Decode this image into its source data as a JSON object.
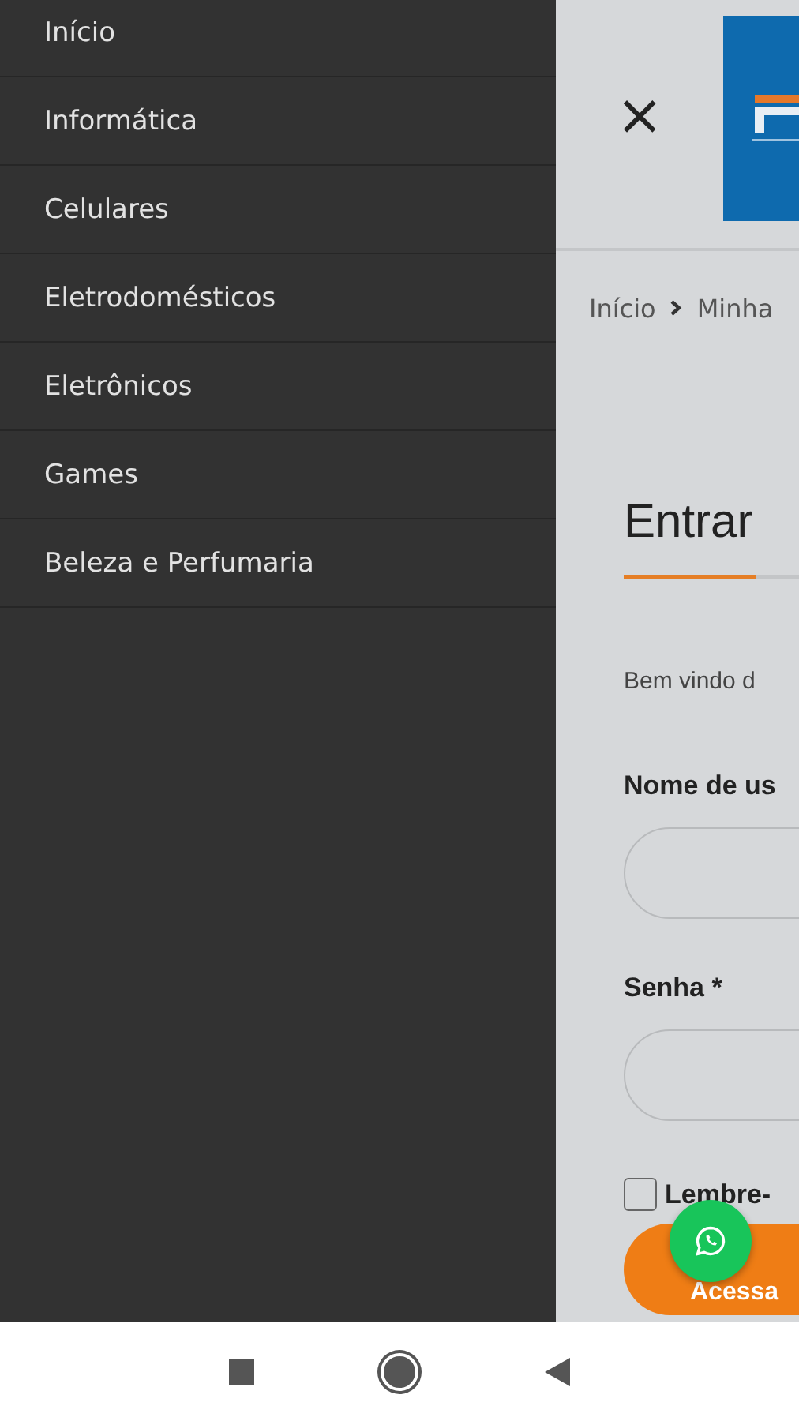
{
  "menu": {
    "items": [
      {
        "label": "Início"
      },
      {
        "label": "Informática"
      },
      {
        "label": "Celulares"
      },
      {
        "label": "Eletrodomésticos"
      },
      {
        "label": "Eletrônicos"
      },
      {
        "label": "Games"
      },
      {
        "label": "Beleza e Perfumaria"
      }
    ]
  },
  "header": {
    "close": "×"
  },
  "breadcrumb": [
    "Início",
    "Minha"
  ],
  "login": {
    "title": "Entrar",
    "welcome": "Bem vindo d",
    "username_label": "Nome de us",
    "password_label": "Senha *",
    "remember": {
      "label": "Lembre-",
      "checked": false
    },
    "submit": "Acessa"
  }
}
